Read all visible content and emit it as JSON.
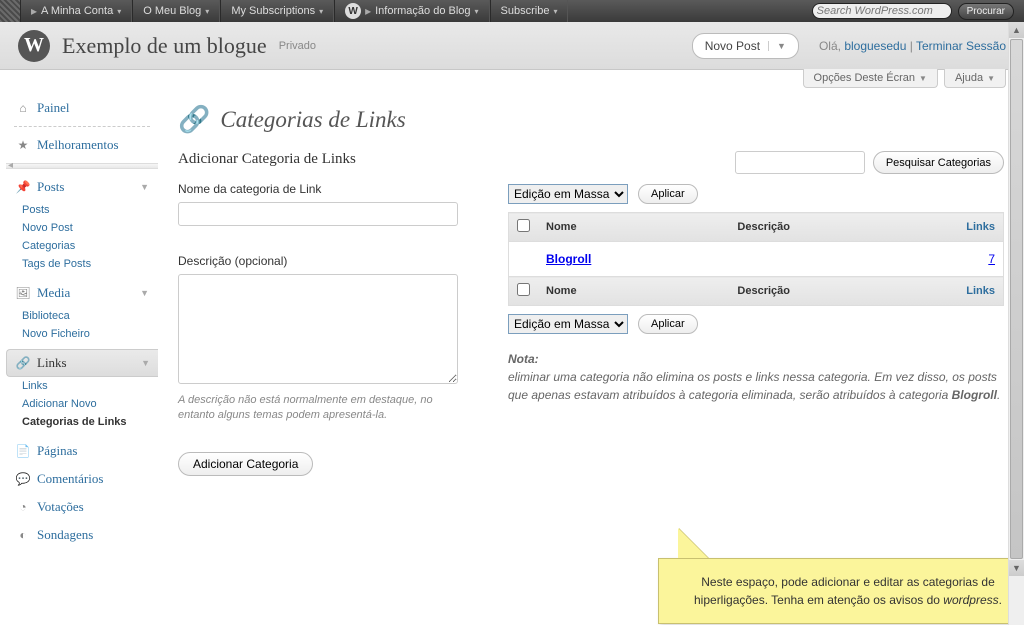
{
  "topbar": {
    "items": [
      "A Minha Conta",
      "O Meu Blog",
      "My Subscriptions",
      "Informação do Blog",
      "Subscribe"
    ],
    "search_placeholder": "Search WordPress.com",
    "search_button": "Procurar"
  },
  "header": {
    "site_title": "Exemplo de um blogue",
    "privacy": "Privado",
    "new_post": "Novo Post",
    "greeting_prefix": "Olá, ",
    "username": "bloguesedu",
    "logout": "Terminar Sessão"
  },
  "screen_tabs": {
    "options": "Opções Deste Écran",
    "help": "Ajuda"
  },
  "sidebar": {
    "dashboard": "Painel",
    "upgrades": "Melhoramentos",
    "posts": {
      "top": "Posts",
      "items": [
        "Posts",
        "Novo Post",
        "Categorias",
        "Tags de Posts"
      ]
    },
    "media": {
      "top": "Media",
      "items": [
        "Biblioteca",
        "Novo Ficheiro"
      ]
    },
    "links": {
      "top": "Links",
      "items": [
        "Links",
        "Adicionar Novo",
        "Categorias de Links"
      ]
    },
    "pages": "Páginas",
    "comments": "Comentários",
    "polls": "Votações",
    "surveys": "Sondagens"
  },
  "page": {
    "title": "Categorias de Links",
    "form_heading": "Adicionar Categoria de Links",
    "name_label": "Nome da categoria de Link",
    "desc_label": "Descrição (opcional)",
    "desc_hint": "A descrição não está normalmente em destaque, no entanto alguns temas podem apresentá-la.",
    "submit": "Adicionar Categoria"
  },
  "list": {
    "search_button": "Pesquisar Categorias",
    "bulk_label": "Edição em Massa",
    "apply": "Aplicar",
    "cols": {
      "name": "Nome",
      "desc": "Descrição",
      "links": "Links"
    },
    "rows": [
      {
        "name": "Blogroll",
        "desc": "",
        "links": "7"
      }
    ]
  },
  "note": {
    "heading": "Nota:",
    "body_1": "eliminar uma categoria não elimina os posts e links nessa categoria. Em vez disso, os posts que apenas estavam atribuídos à categoria eliminada, serão atribuídos à categoria ",
    "bold": "Blogroll",
    "body_2": "."
  },
  "callout": {
    "line1": "Neste espaço, pode adicionar e editar as categorias de hiperligações. Tenha em atenção os avisos do ",
    "em": "wordpress",
    "line2": "."
  }
}
